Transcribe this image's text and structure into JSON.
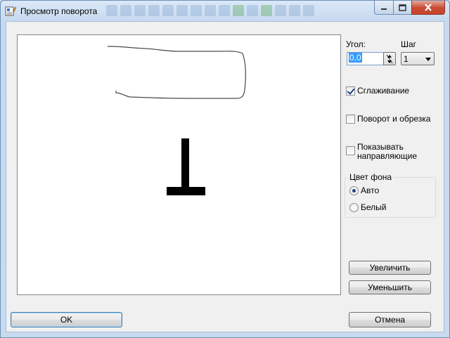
{
  "window": {
    "title": "Просмотр поворота"
  },
  "controls": {
    "angle_label": "Угол:",
    "angle_value": "0,0",
    "step_label": "Шаг",
    "step_value": "1",
    "smoothing_label": "Сглаживание",
    "smoothing_checked": true,
    "rotate_crop_label": "Поворот и обрезка",
    "rotate_crop_checked": false,
    "show_guides_label_line1": "Показывать",
    "show_guides_label_line2": "направляющие",
    "show_guides_checked": false,
    "bg_group_title": "Цвет фона",
    "bg_auto_label": "Авто",
    "bg_white_label": "Белый",
    "bg_selected": "Авто",
    "zoom_in_label": "Увеличить",
    "zoom_out_label": "Уменьшить"
  },
  "footer": {
    "ok_label": "OK",
    "cancel_label": "Отмена"
  },
  "colors": {
    "selection": "#3399ff",
    "close_button": "#c7442a",
    "checkmark": "#1f3c8c"
  }
}
